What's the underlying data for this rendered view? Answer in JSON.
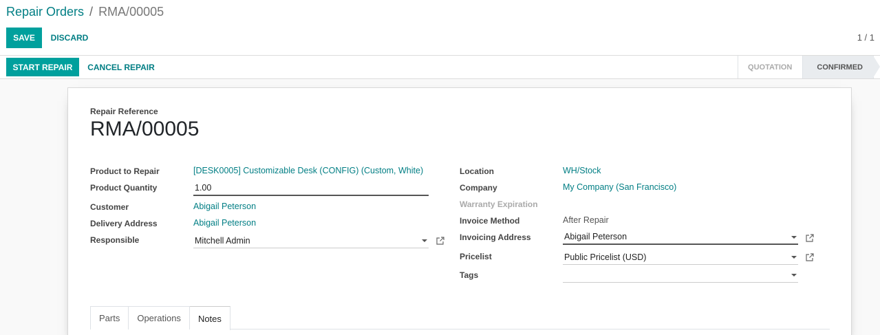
{
  "breadcrumb": {
    "parent": "Repair Orders",
    "separator": "/",
    "current": "RMA/00005"
  },
  "buttons": {
    "save": "SAVE",
    "discard": "DISCARD",
    "start_repair": "START REPAIR",
    "cancel_repair": "CANCEL REPAIR"
  },
  "pager": "1 / 1",
  "status": {
    "steps": [
      "QUOTATION",
      "CONFIRMED"
    ],
    "active": "CONFIRMED"
  },
  "form": {
    "reference_label": "Repair Reference",
    "reference": "RMA/00005",
    "left": {
      "product_label": "Product to Repair",
      "product": "[DESK0005] Customizable Desk (CONFIG) (Custom, White)",
      "quantity_label": "Product Quantity",
      "quantity": "1.00",
      "customer_label": "Customer",
      "customer": "Abigail Peterson",
      "delivery_label": "Delivery Address",
      "delivery": "Abigail Peterson",
      "responsible_label": "Responsible",
      "responsible": "Mitchell Admin"
    },
    "right": {
      "location_label": "Location",
      "location": "WH/Stock",
      "company_label": "Company",
      "company": "My Company (San Francisco)",
      "warranty_label": "Warranty Expiration",
      "invoice_method_label": "Invoice Method",
      "invoice_method": "After Repair",
      "invoicing_address_label": "Invoicing Address",
      "invoicing_address": "Abigail Peterson",
      "pricelist_label": "Pricelist",
      "pricelist": "Public Pricelist (USD)",
      "tags_label": "Tags",
      "tags": ""
    },
    "tabs": [
      "Parts",
      "Operations",
      "Notes"
    ],
    "active_tab": "Notes"
  },
  "colors": {
    "primary": "#00a09d",
    "link": "#017e84"
  },
  "icons": {
    "external": "external-link-icon",
    "dropdown": "caret-down-icon"
  }
}
